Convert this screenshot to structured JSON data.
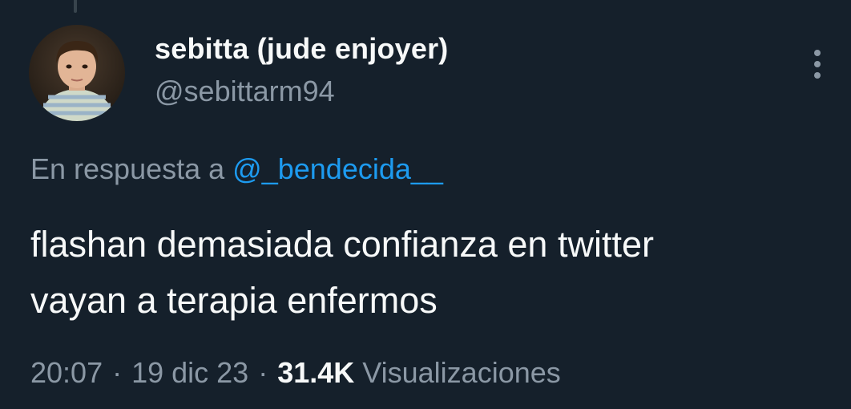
{
  "tweet": {
    "author": {
      "display_name": "sebitta (jude enjoyer)",
      "handle": "@sebittarm94",
      "avatar": "child-portrait-photo"
    },
    "reply_to": {
      "prefix": "En respuesta a",
      "mention": "@_bendecida__"
    },
    "text_lines": [
      "flashan demasiada confianza en twitter",
      "vayan a terapia enfermos"
    ],
    "time": "20:07",
    "date": "19 dic 23",
    "separator": "·",
    "views_count": "31.4K",
    "views_label": "Visualizaciones"
  },
  "icons": {
    "more": "more-options-icon"
  },
  "colors": {
    "background": "#15202b",
    "primary_text": "#f7f9f9",
    "secondary_text": "#8b98a5",
    "accent": "#1d9bf0",
    "thread_line": "#38444d"
  }
}
